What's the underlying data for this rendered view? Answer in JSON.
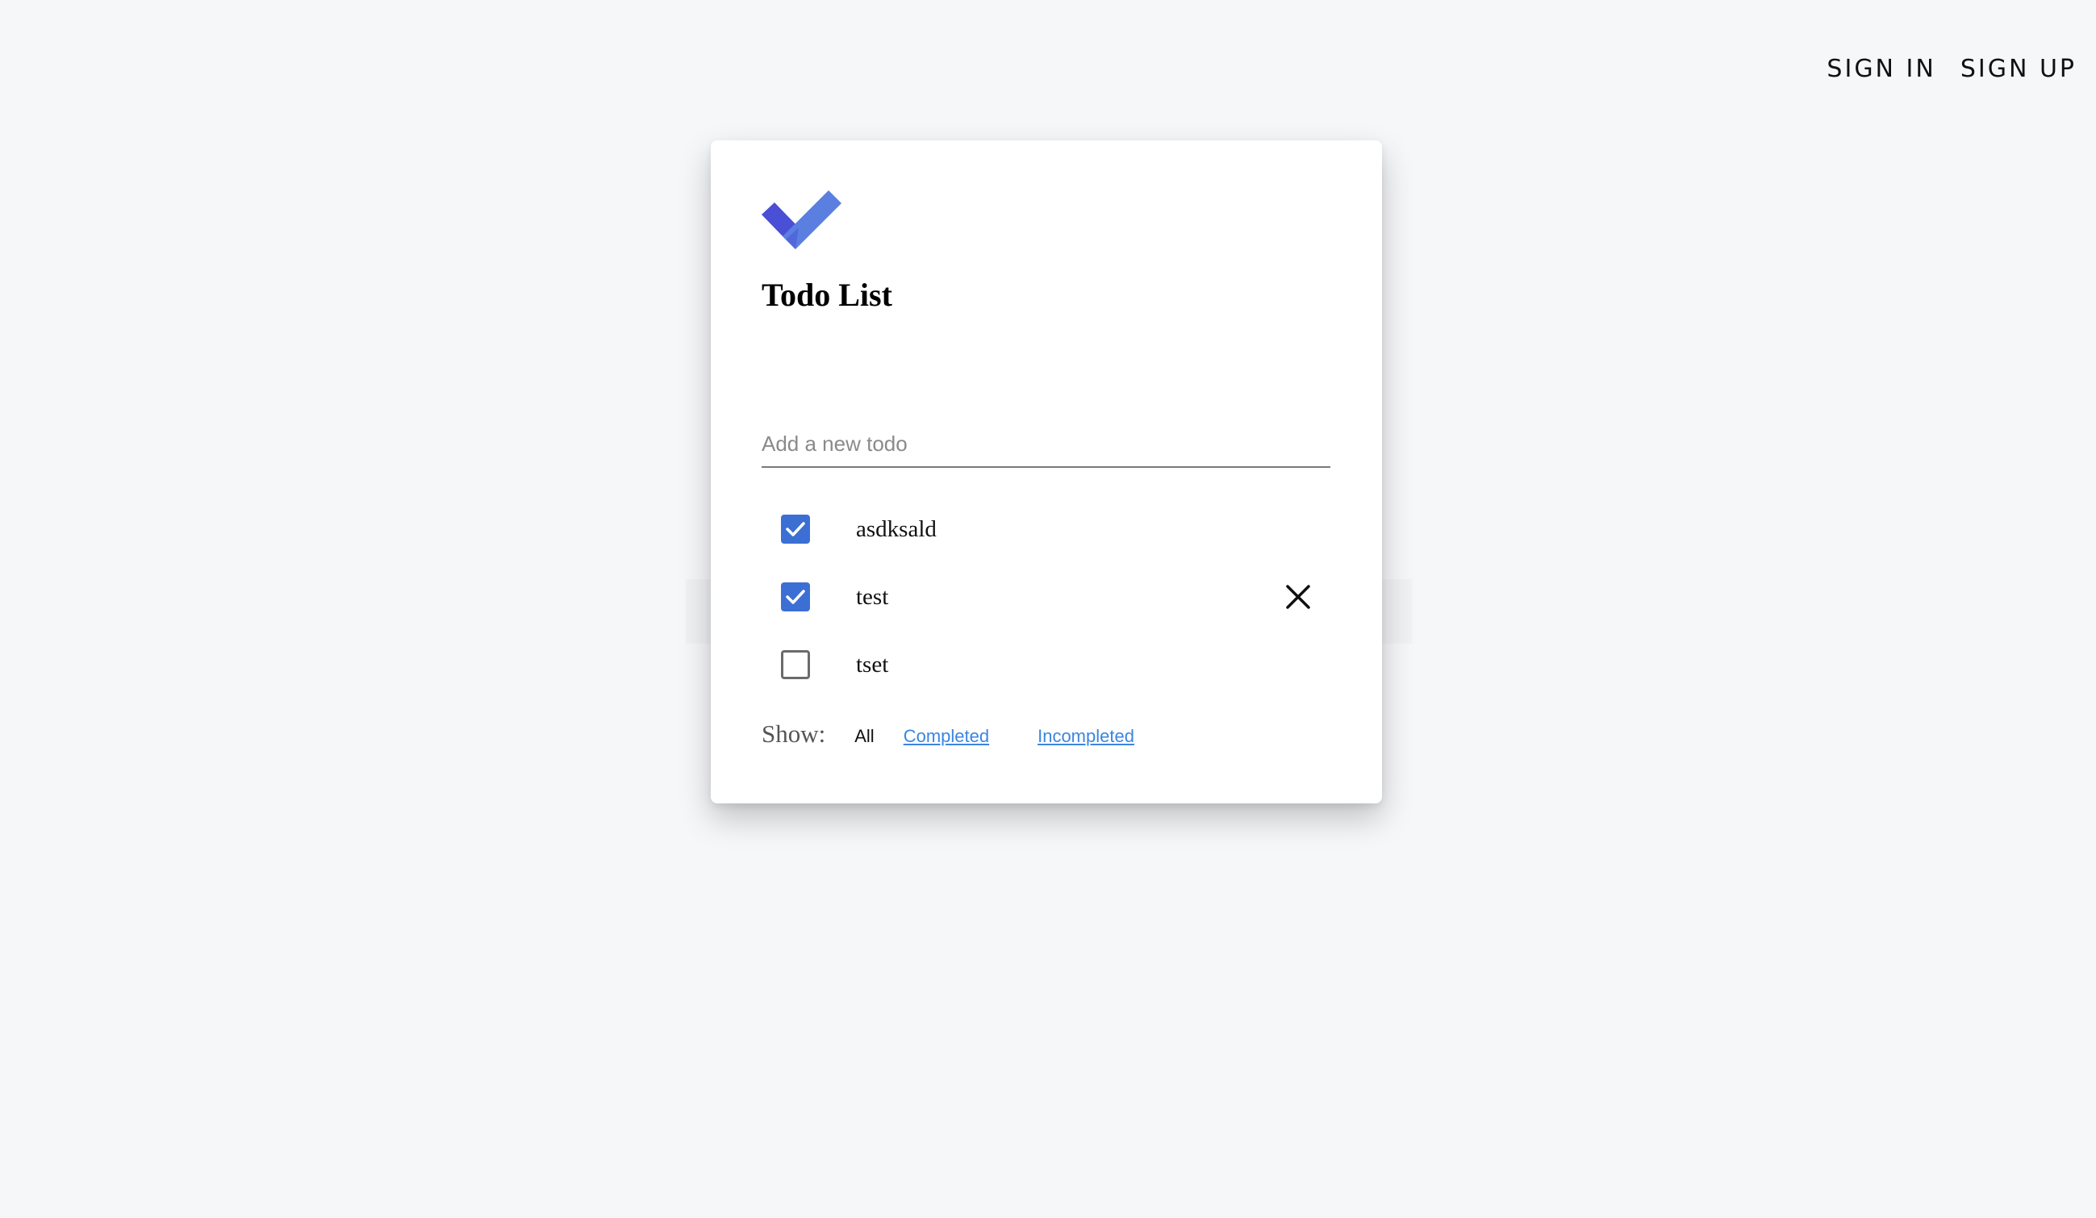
{
  "nav": {
    "sign_in": "SIGN IN",
    "sign_up": "SIGN UP"
  },
  "app": {
    "title": "Todo List",
    "logo_icon": "double-check-icon",
    "brand_colors": {
      "logo_dark": "#4a4fd6",
      "logo_light": "#5b7fe0",
      "checkbox": "#3b6fd4",
      "link": "#3a86e0"
    }
  },
  "new_todo": {
    "value": "",
    "placeholder": "Add a new todo"
  },
  "todos": [
    {
      "text": "asdksald",
      "completed": true
    },
    {
      "text": "test",
      "completed": true,
      "delete_icon": "close-icon"
    },
    {
      "text": "tset",
      "completed": false
    }
  ],
  "filters": {
    "label": "Show:",
    "all": "All",
    "completed": "Completed",
    "incompleted": "Incompleted"
  }
}
